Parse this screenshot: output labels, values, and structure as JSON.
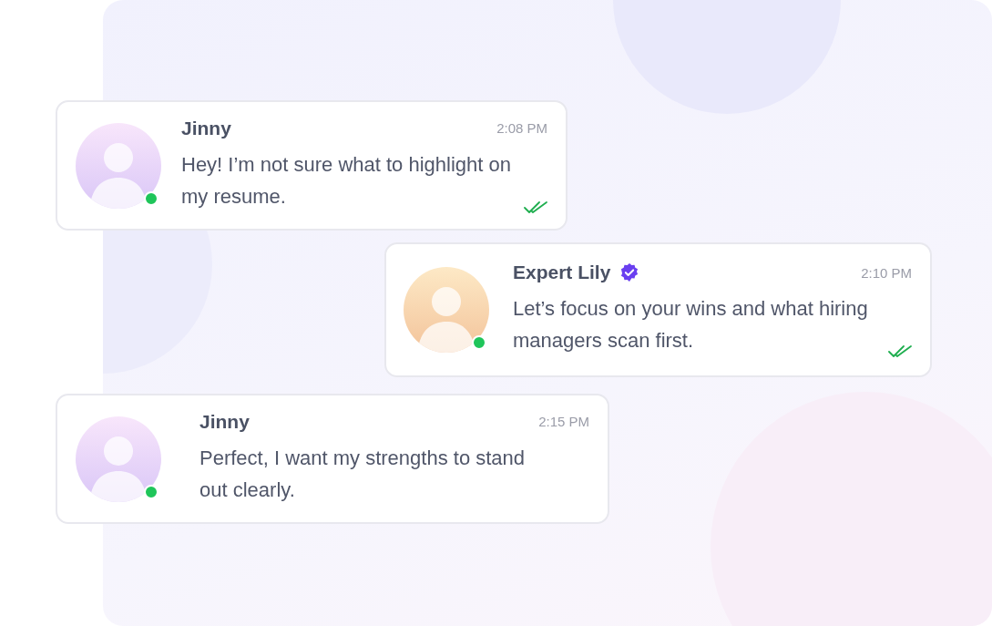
{
  "messages": [
    {
      "kind": "client",
      "name": "Jinny",
      "time": "2:08 PM",
      "text": "Hey! I’m not sure what to highlight on my resume.",
      "online": true,
      "verified": false,
      "read": true
    },
    {
      "kind": "expert",
      "name": "Expert Lily",
      "time": "2:10 PM",
      "text": "Let’s focus on your wins and what hiring managers scan first.",
      "online": true,
      "verified": true,
      "read": true
    },
    {
      "kind": "client",
      "name": "Jinny",
      "time": "2:15 PM",
      "text": "Perfect, I want my strengths to stand out clearly.",
      "online": true,
      "verified": false,
      "read": false
    }
  ]
}
